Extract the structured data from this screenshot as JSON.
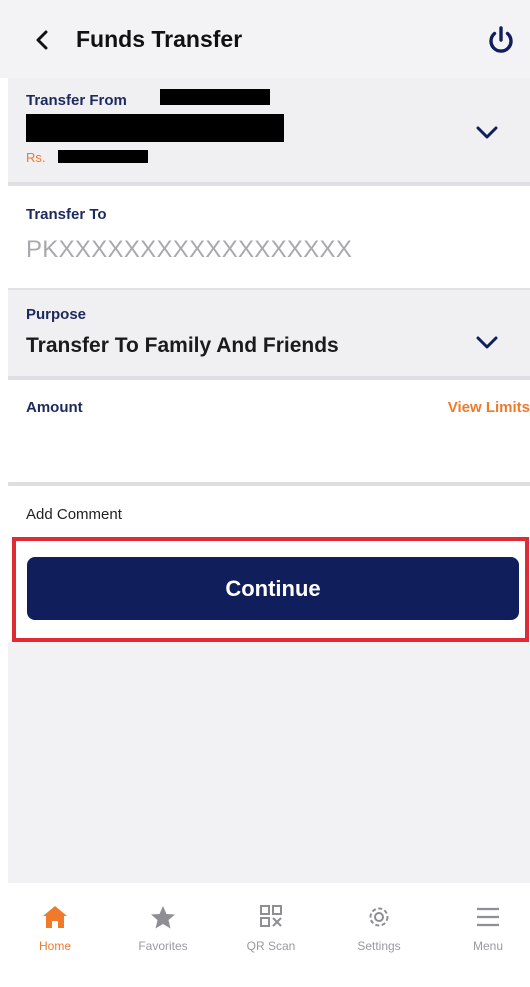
{
  "header": {
    "title": "Funds Transfer"
  },
  "transfer_from": {
    "label": "Transfer From",
    "balance_prefix": "Rs."
  },
  "transfer_to": {
    "label": "Transfer To",
    "value": "PKXXXXXXXXXXXXXXXXXX"
  },
  "purpose": {
    "label": "Purpose",
    "value": "Transfer To Family And Friends"
  },
  "amount": {
    "label": "Amount",
    "view_limits": "View Limits"
  },
  "comment": {
    "label": "Add Comment"
  },
  "continue_label": "Continue",
  "tabs": [
    {
      "label": "Home",
      "icon": "home-icon",
      "active": true
    },
    {
      "label": "Favorites",
      "icon": "star-icon",
      "active": false
    },
    {
      "label": "QR Scan",
      "icon": "qr-icon",
      "active": false
    },
    {
      "label": "Settings",
      "icon": "gear-icon",
      "active": false
    },
    {
      "label": "Menu",
      "icon": "menu-icon",
      "active": false
    }
  ],
  "colors": {
    "navy": "#101f5c",
    "accent": "#f07a2c",
    "highlight": "#e02b36",
    "label": "#1d2a5c"
  }
}
